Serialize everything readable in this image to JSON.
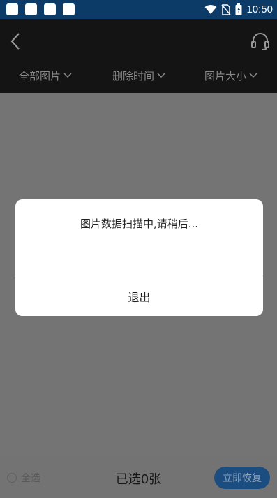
{
  "status_bar": {
    "time": "10:50",
    "icons": [
      "notification-icon",
      "notification-icon",
      "notification-icon",
      "notification-icon",
      "wifi-icon",
      "no-sim-icon",
      "battery-charging-icon"
    ]
  },
  "header": {
    "back_icon": "chevron-left-icon",
    "support_icon": "headset-icon"
  },
  "filters": [
    {
      "label": "全部图片",
      "icon": "chevron-down-icon"
    },
    {
      "label": "删除时间",
      "icon": "chevron-down-icon"
    },
    {
      "label": "图片大小",
      "icon": "chevron-down-icon"
    }
  ],
  "dialog": {
    "message": "图片数据扫描中,请稍后...",
    "exit_label": "退出"
  },
  "bottom_bar": {
    "select_all_label": "全选",
    "selected_count": "已选0张",
    "restore_label": "立即恢复"
  },
  "colors": {
    "status_bar": "#0b3b66",
    "header": "#141414",
    "overlay": "#747474",
    "restore_button": "#1c4d80"
  }
}
